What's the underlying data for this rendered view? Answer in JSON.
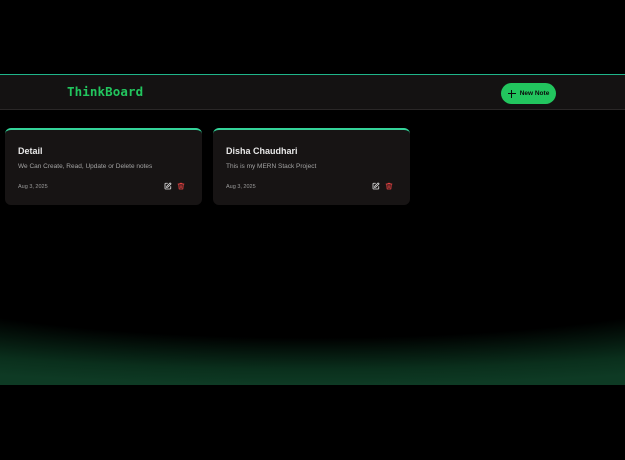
{
  "app": {
    "name": "ThinkBoard"
  },
  "navbar": {
    "logo_text": "ThinkBoard",
    "new_note_label": "New Note",
    "new_note_icon": "plus-icon"
  },
  "notes": [
    {
      "title": "Detail",
      "content": "We Can Create, Read, Update or Delete notes",
      "date": "Aug 3, 2025",
      "edit_icon": "edit-icon",
      "delete_icon": "trash-icon"
    },
    {
      "title": "Disha Chaudhari",
      "content": "This is my MERN Stack Project",
      "date": "Aug 3, 2025",
      "edit_icon": "edit-icon",
      "delete_icon": "trash-icon"
    }
  ],
  "colors": {
    "background": "#000000",
    "navbar": "#141212",
    "accent": "#22c55e",
    "card": "#171414",
    "card_border": "#34d399",
    "delete": "#ef4444"
  }
}
